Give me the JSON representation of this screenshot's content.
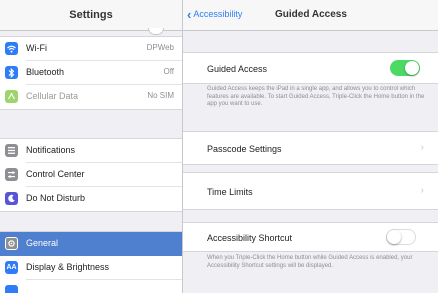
{
  "settings": {
    "title": "Settings",
    "wifi": {
      "label": "Wi-Fi",
      "value": "DPWeb",
      "icon": "wifi-icon",
      "color": "#2f7df6"
    },
    "bluetooth": {
      "label": "Bluetooth",
      "value": "Off",
      "icon": "bluetooth-icon",
      "color": "#2f7df6"
    },
    "cellular": {
      "label": "Cellular Data",
      "value": "No SIM",
      "icon": "cellular-icon",
      "color": "#9ed46e"
    },
    "notifications": {
      "label": "Notifications",
      "icon": "notifications-icon",
      "color": "#8e8e93"
    },
    "control_center": {
      "label": "Control Center",
      "icon": "control-center-icon",
      "color": "#8e8e93"
    },
    "do_not_disturb": {
      "label": "Do Not Disturb",
      "icon": "moon-icon",
      "color": "#5856d6"
    },
    "general": {
      "label": "General",
      "icon": "gear-icon",
      "color": "#8e8e93"
    },
    "display": {
      "label": "Display & Brightness",
      "icon": "display-icon",
      "color": "#2f7df6"
    }
  },
  "guided": {
    "back_label": "Accessibility",
    "title": "Guided Access",
    "guided_access_label": "Guided Access",
    "guided_access_on": true,
    "guided_access_desc": "Guided Access keeps the iPad in a single app, and allows you to control which features are available. To start Guided Access, Triple-Click the Home button in the app you want to use.",
    "passcode_label": "Passcode Settings",
    "time_limits_label": "Time Limits",
    "shortcut_label": "Accessibility Shortcut",
    "shortcut_on": false,
    "shortcut_desc": "When you Triple-Click the Home button while Guided Access is enabled, your Accessibility Shortcut settings will be displayed."
  },
  "colors": {
    "accent": "#2f7df6",
    "selected": "#4f7fcf",
    "toggle_on": "#4cd964"
  }
}
